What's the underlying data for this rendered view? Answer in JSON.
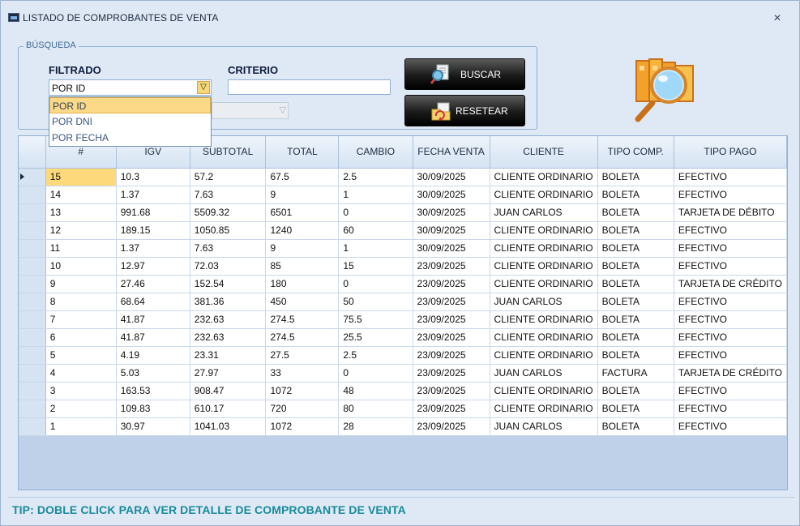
{
  "window": {
    "title": "LISTADO DE COMPROBANTES DE VENTA",
    "close_icon": "×"
  },
  "search": {
    "group_title": "BÚSQUEDA",
    "filter_label": "FILTRADO",
    "criteria_label": "CRITERIO",
    "filter_value": "POR ID",
    "filter_options": [
      "POR ID",
      "POR DNI",
      "POR FECHA"
    ],
    "criteria_value": "",
    "buscar_label": "BUSCAR",
    "resetear_label": "RESETEAR"
  },
  "grid": {
    "columns": [
      "#",
      "IGV",
      "SUBTOTAL",
      "TOTAL",
      "CAMBIO",
      "FECHA VENTA",
      "CLIENTE",
      "TIPO COMP.",
      "TIPO PAGO"
    ],
    "rows": [
      [
        "15",
        "10.3",
        "57.2",
        "67.5",
        "2.5",
        "30/09/2025",
        "CLIENTE ORDINARIO",
        "BOLETA",
        "EFECTIVO"
      ],
      [
        "14",
        "1.37",
        "7.63",
        "9",
        "1",
        "30/09/2025",
        "CLIENTE ORDINARIO",
        "BOLETA",
        "EFECTIVO"
      ],
      [
        "13",
        "991.68",
        "5509.32",
        "6501",
        "0",
        "30/09/2025",
        "JUAN CARLOS",
        "BOLETA",
        "TARJETA DE DÉBITO"
      ],
      [
        "12",
        "189.15",
        "1050.85",
        "1240",
        "60",
        "30/09/2025",
        "CLIENTE ORDINARIO",
        "BOLETA",
        "EFECTIVO"
      ],
      [
        "11",
        "1.37",
        "7.63",
        "9",
        "1",
        "30/09/2025",
        "CLIENTE ORDINARIO",
        "BOLETA",
        "EFECTIVO"
      ],
      [
        "10",
        "12.97",
        "72.03",
        "85",
        "15",
        "23/09/2025",
        "CLIENTE ORDINARIO",
        "BOLETA",
        "EFECTIVO"
      ],
      [
        "9",
        "27.46",
        "152.54",
        "180",
        "0",
        "23/09/2025",
        "CLIENTE ORDINARIO",
        "BOLETA",
        "TARJETA DE CRÉDITO"
      ],
      [
        "8",
        "68.64",
        "381.36",
        "450",
        "50",
        "23/09/2025",
        "JUAN CARLOS",
        "BOLETA",
        "EFECTIVO"
      ],
      [
        "7",
        "41.87",
        "232.63",
        "274.5",
        "75.5",
        "23/09/2025",
        "CLIENTE ORDINARIO",
        "BOLETA",
        "EFECTIVO"
      ],
      [
        "6",
        "41.87",
        "232.63",
        "274.5",
        "25.5",
        "23/09/2025",
        "CLIENTE ORDINARIO",
        "BOLETA",
        "EFECTIVO"
      ],
      [
        "5",
        "4.19",
        "23.31",
        "27.5",
        "2.5",
        "23/09/2025",
        "CLIENTE ORDINARIO",
        "BOLETA",
        "EFECTIVO"
      ],
      [
        "4",
        "5.03",
        "27.97",
        "33",
        "0",
        "23/09/2025",
        "JUAN CARLOS",
        "FACTURA",
        "TARJETA DE CRÉDITO"
      ],
      [
        "3",
        "163.53",
        "908.47",
        "1072",
        "48",
        "23/09/2025",
        "CLIENTE ORDINARIO",
        "BOLETA",
        "EFECTIVO"
      ],
      [
        "2",
        "109.83",
        "610.17",
        "720",
        "80",
        "23/09/2025",
        "CLIENTE ORDINARIO",
        "BOLETA",
        "EFECTIVO"
      ],
      [
        "1",
        "30.97",
        "1041.03",
        "1072",
        "28",
        "23/09/2025",
        "JUAN CARLOS",
        "BOLETA",
        "EFECTIVO"
      ]
    ]
  },
  "footer": {
    "tip": "TIP: DOBLE CLICK PARA VER DETALLE DE COMPROBANTE DE VENTA"
  },
  "colors": {
    "accent": "#188a9a",
    "selection": "#fdd97c",
    "grid_bg": "#bed1e9"
  },
  "icons": [
    "app-icon",
    "close-icon",
    "dropdown-arrow-icon",
    "search-document-icon",
    "reset-folder-icon",
    "magnifier-books-logo",
    "row-indicator-icon"
  ]
}
